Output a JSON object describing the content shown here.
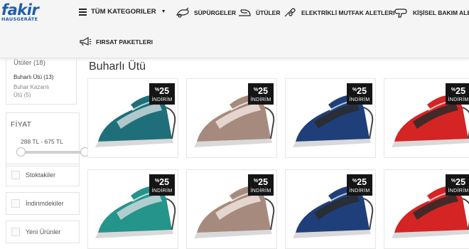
{
  "brand": {
    "name": "fakir",
    "subtitle": "HAUSGERÄTE"
  },
  "nav": {
    "all_categories": "TÜM KATEGORILER",
    "items": [
      {
        "label": "SÜPÜRGELER",
        "icon": "vacuum-icon"
      },
      {
        "label": "ÜTÜLER",
        "icon": "iron-icon"
      },
      {
        "label": "ELEKTRİKLİ MUTFAK ALETLERI",
        "icon": "mixer-icon"
      },
      {
        "label": "KİŞİSEL BAKIM ALETL",
        "icon": "hairdryer-icon"
      },
      {
        "label": "FIRSAT PAKETLERI",
        "icon": "megaphone-icon"
      }
    ]
  },
  "sidebar": {
    "category_parent": "Ütüler (18)",
    "categories": [
      {
        "label": "Buharlı Ütü (13)"
      },
      {
        "label": "Buhar Kazanlı"
      },
      {
        "label": "Ütü (5)"
      }
    ],
    "price": {
      "title": "FİYAT",
      "range": "288 TL - 675 TL"
    },
    "filters": [
      {
        "label": "Stoktakiler"
      },
      {
        "label": "İndirimdekiler"
      },
      {
        "label": "Yeni Ürünler"
      }
    ]
  },
  "page_title": "Buharlı Ütü",
  "badge": {
    "percent_sign": "%",
    "value": "25",
    "label": "İNDİRİM"
  },
  "products": [
    {
      "color": "#1f6f7a",
      "accent": "#c9d8da"
    },
    {
      "color": "#a68a7e",
      "accent": "#efe2dc"
    },
    {
      "color": "#1f3f7a",
      "accent": "#2a2a2a"
    },
    {
      "color": "#d42424",
      "accent": "#2a2a2a"
    },
    {
      "color": "#25948a",
      "accent": "#c9d8da"
    },
    {
      "color": "#a68a7e",
      "accent": "#efe2dc"
    },
    {
      "color": "#1f3f7a",
      "accent": "#2a2a2a"
    },
    {
      "color": "#d42424",
      "accent": "#2a2a2a"
    }
  ]
}
